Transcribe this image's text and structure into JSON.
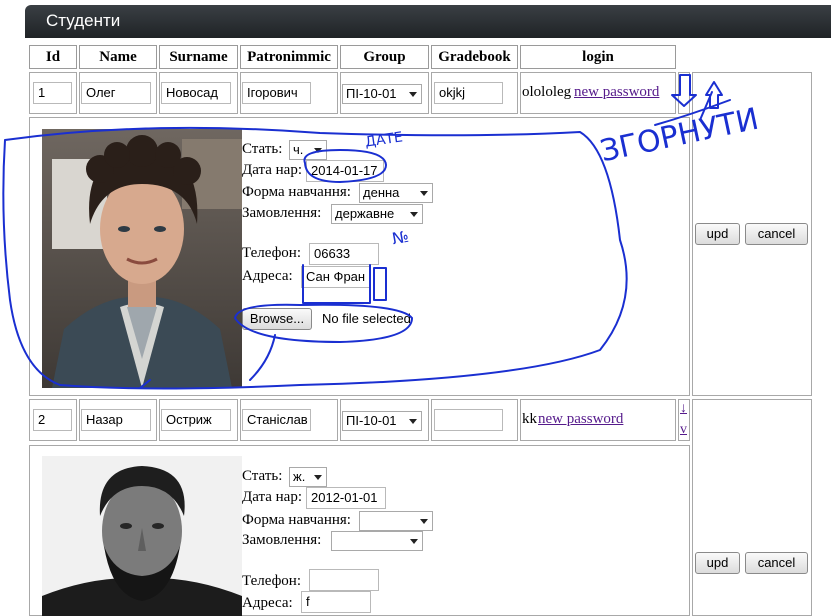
{
  "panel": {
    "title": "Студенти"
  },
  "columns": [
    "Id",
    "Name",
    "Surname",
    "Patronimmic",
    "Group",
    "Gradebook",
    "login"
  ],
  "students": [
    {
      "id": "1",
      "name": "Олег",
      "surname": "Новосад",
      "patronymic": "Ігорович",
      "group": "ПІ-10-01",
      "gradebook": "okjkj",
      "login": "olololeg",
      "password_link": "new password",
      "details": {
        "sex_label": "Стать:",
        "sex": "ч.",
        "birth_label": "Дата нар:",
        "birth": "2014-01-17",
        "study_form_label": "Форма навчання:",
        "study_form": "денна",
        "order_label": "Замовлення:",
        "order": "державне",
        "phone_label": "Телефон:",
        "phone": "06633",
        "address_label": "Адреса:",
        "address": "Сан Фран",
        "browse": "Browse...",
        "file_status": "No file selected",
        "upd": "upd",
        "cancel": "cancel"
      }
    },
    {
      "id": "2",
      "name": "Назар",
      "surname": "Остриж",
      "patronymic": "Станіслав",
      "group": "ПІ-10-01",
      "gradebook": "",
      "login": "kk",
      "password_link": "new password",
      "side_glyph": "↓",
      "side_glyph2": "v",
      "details": {
        "sex_label": "Стать:",
        "sex": "ж.",
        "birth_label": "Дата нар:",
        "birth": "2012-01-01",
        "study_form_label": "Форма навчання:",
        "study_form": "",
        "order_label": "Замовлення:",
        "order": "",
        "phone_label": "Телефон:",
        "phone": "",
        "address_label": "Адреса:",
        "address": "f",
        "upd": "upd",
        "cancel": "cancel"
      }
    }
  ],
  "annotations": {
    "collapse": "ЗГОРНУТИ",
    "date_note": "ДАТЕ",
    "number_note": "№"
  }
}
